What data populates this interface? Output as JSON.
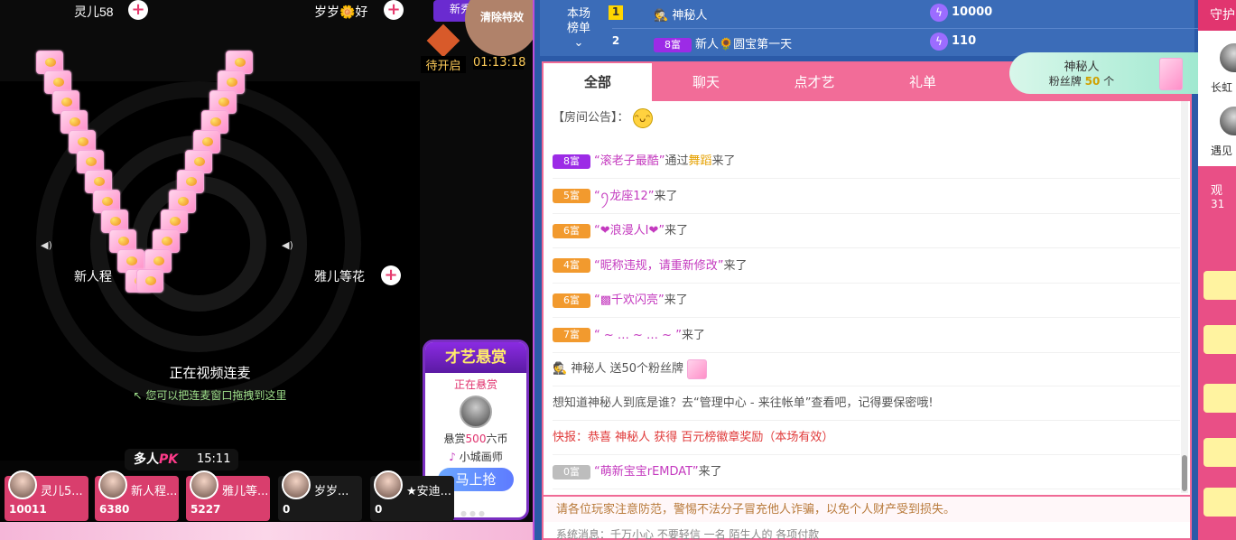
{
  "video": {
    "host_left": "灵儿58",
    "host_right": "岁岁🌼好",
    "new_label": "新秀",
    "timer_pending": "待开启",
    "timer_value": "01:13:18",
    "clear_effects": "清除特效",
    "seat_left": "新人程",
    "seat_right": "雅儿等花",
    "link_status": "正在视频连麦",
    "drag_hint": "您可以把连麦窗口拖拽到这里",
    "pk_label": "多人",
    "pk_word": "PK",
    "pk_time": "15:11",
    "pk_players": [
      {
        "name": "灵儿5...",
        "score": "10011"
      },
      {
        "name": "新人程...",
        "score": "6380"
      },
      {
        "name": "雅儿等...",
        "score": "5227"
      },
      {
        "name": "岁岁...",
        "score": "0"
      },
      {
        "name": "★安迪...",
        "score": "0"
      }
    ],
    "bounty": {
      "title": "才艺悬赏",
      "status": "正在悬赏",
      "reward_prefix": "悬赏",
      "reward_amount": "500",
      "reward_unit": "六币",
      "target": "小城画师",
      "button": "马上抢"
    }
  },
  "rank": {
    "label_line1": "本场",
    "label_line2": "榜单",
    "rows": [
      {
        "num": "1",
        "user": "神秘人",
        "value": "10000"
      },
      {
        "num": "2",
        "badge": "8富",
        "user": "新人🌻圆宝第一天",
        "value": "110"
      }
    ]
  },
  "fans": {
    "name": "神秘人",
    "label": "粉丝牌",
    "count": "50",
    "unit": "个"
  },
  "tabs": [
    "全部",
    "聊天",
    "点才艺",
    "礼单"
  ],
  "announcement": "【房间公告】：",
  "messages": [
    {
      "badge": "8富",
      "cls": "b8",
      "user": "“滚老子最酷”",
      "mid": "通过",
      "extra": "舞蹈",
      "tail": "来了"
    },
    {
      "badge": "5富",
      "cls": "b5",
      "user": "“ꪆ龙座12”",
      "mid": "",
      "extra": "",
      "tail": "来了"
    },
    {
      "badge": "6富",
      "cls": "b6",
      "user": "“❤浪漫人I❤”",
      "mid": "",
      "extra": "",
      "tail": "来了"
    },
    {
      "badge": "4富",
      "cls": "b4",
      "user": "“昵称违规，请重新修改”",
      "mid": "",
      "extra": "",
      "tail": "来了"
    },
    {
      "badge": "6富",
      "cls": "b6",
      "user": "“▩千欢闪亮”",
      "mid": "",
      "extra": "",
      "tail": "来了"
    },
    {
      "badge": "7富",
      "cls": "b7",
      "user": "“ ~ … ~ … ~ ”",
      "mid": "",
      "extra": "",
      "tail": "来了"
    }
  ],
  "gift_msg": "神秘人 送50个粉丝牌",
  "tip_msg": "想知道神秘人到底是谁？去“管理中心 - 来往帐单”查看吧，记得要保密哦!",
  "flash_msg": "快报：恭喜 神秘人 获得 百元榜徽章奖励（本场有效）",
  "last_msg": {
    "badge": "0富",
    "user": "“萌新宝宝rEMDAT”",
    "tail": "来了"
  },
  "notice": "请各位玩家注意防范，警惕不法分子冒充他人诈骗，以免个人财产受到损失。",
  "notice2": "系统消息：千万小心 不要轻信 一名 陌生人的 各项付款",
  "far_right": {
    "top": "守护",
    "items": [
      "长虹",
      "遇见",
      "观",
      "31"
    ]
  }
}
